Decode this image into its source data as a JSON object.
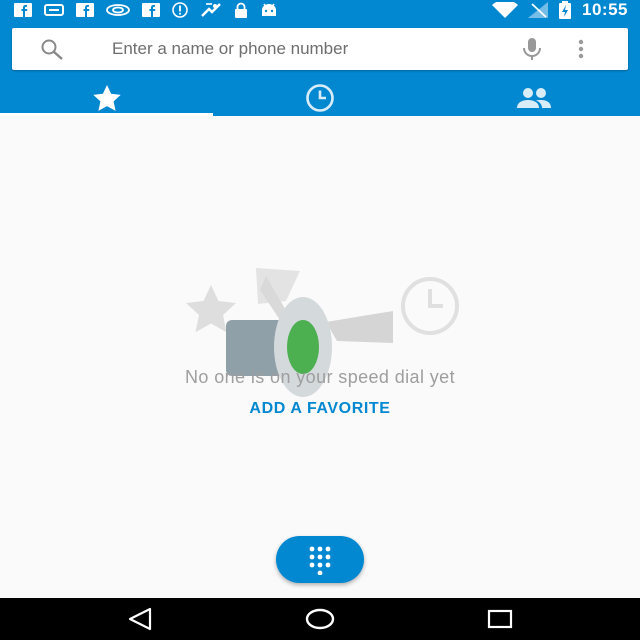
{
  "status_bar": {
    "time": "10:55",
    "notification_icons": [
      "facebook-icon",
      "message-icon",
      "facebook-icon",
      "nvidia-icon",
      "facebook-icon",
      "alert-icon",
      "fitness-icon",
      "lock-icon",
      "android-icon"
    ],
    "system_icons": [
      "wifi-icon",
      "no-signal-icon",
      "battery-charging-icon"
    ]
  },
  "search": {
    "placeholder": "Enter a name or phone number",
    "value": ""
  },
  "tabs": [
    {
      "name": "speed-dial",
      "icon": "star-icon",
      "selected": true
    },
    {
      "name": "recents",
      "icon": "clock-icon",
      "selected": false
    },
    {
      "name": "contacts",
      "icon": "people-icon",
      "selected": false
    }
  ],
  "empty_state": {
    "message": "No one is on your speed dial yet",
    "action_label": "ADD A FAVORITE"
  },
  "fab": {
    "icon": "dialpad-icon"
  },
  "nav": [
    "back-icon",
    "home-icon",
    "recents-icon"
  ],
  "colors": {
    "primary": "#0288d1",
    "background": "#fafafa",
    "accent_green": "#4caf50"
  }
}
